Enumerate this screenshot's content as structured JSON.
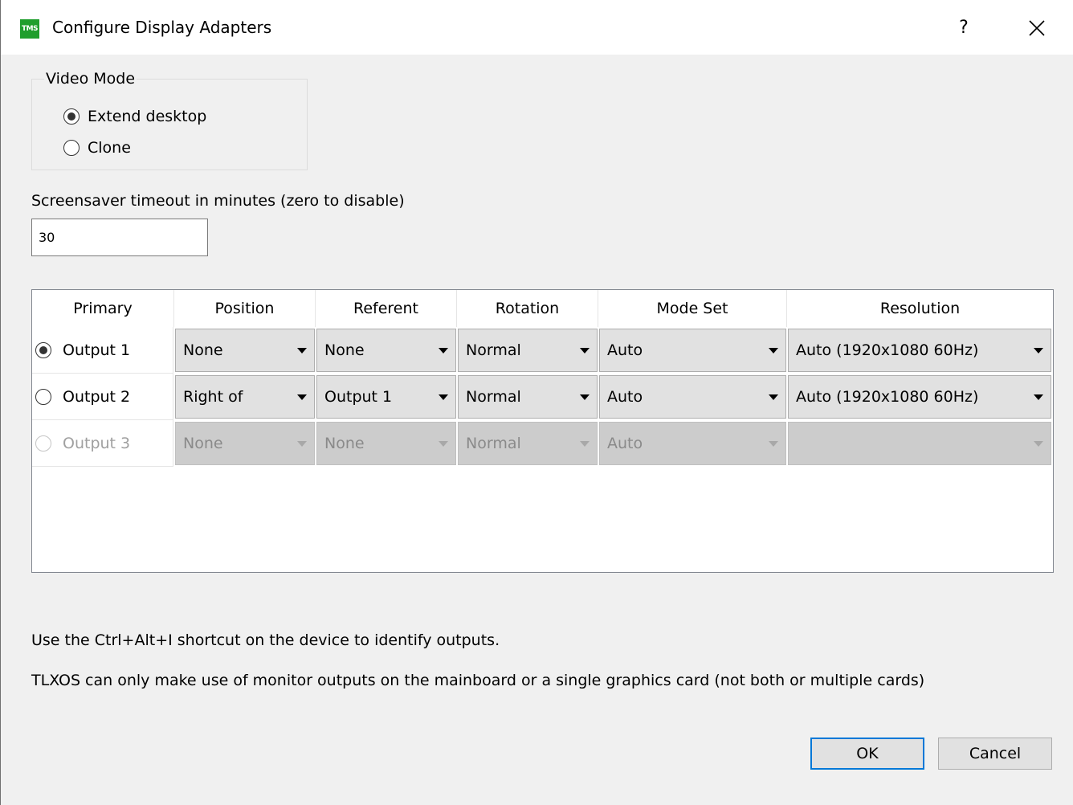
{
  "window": {
    "title": "Configure Display Adapters",
    "icon_text": "TMS",
    "help_label": "?",
    "close_icon": "close-icon"
  },
  "video_mode": {
    "legend": "Video Mode",
    "options": [
      {
        "label": "Extend desktop",
        "selected": true
      },
      {
        "label": "Clone",
        "selected": false
      }
    ]
  },
  "screensaver": {
    "label": "Screensaver timeout in minutes (zero to disable)",
    "value": "30"
  },
  "table": {
    "headers": [
      "Primary",
      "Position",
      "Referent",
      "Rotation",
      "Mode Set",
      "Resolution"
    ],
    "rows": [
      {
        "output": "Output 1",
        "primary": true,
        "enabled": true,
        "position": "None",
        "referent": "None",
        "rotation": "Normal",
        "mode_set": "Auto",
        "resolution": "Auto (1920x1080 60Hz)"
      },
      {
        "output": "Output 2",
        "primary": false,
        "enabled": true,
        "position": "Right of",
        "referent": "Output 1",
        "rotation": "Normal",
        "mode_set": "Auto",
        "resolution": "Auto (1920x1080 60Hz)"
      },
      {
        "output": "Output 3",
        "primary": false,
        "enabled": false,
        "position": "None",
        "referent": "None",
        "rotation": "Normal",
        "mode_set": "Auto",
        "resolution": ""
      }
    ]
  },
  "notes": [
    "Use the Ctrl+Alt+I shortcut on the device to identify outputs.",
    "TLXOS can only make use of monitor outputs on the mainboard or a single graphics card (not both or multiple cards)"
  ],
  "buttons": {
    "ok": "OK",
    "cancel": "Cancel"
  },
  "colors": {
    "accent": "#0078d7",
    "app_icon": "#1f9e2c"
  }
}
